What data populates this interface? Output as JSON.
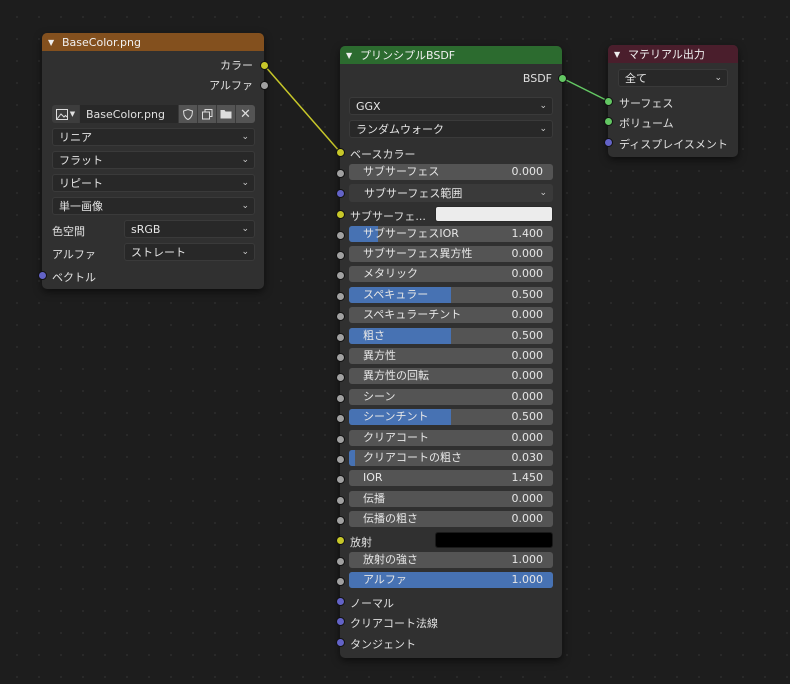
{
  "nodes": {
    "image": {
      "title": "BaseColor.png",
      "header_color": "#83501e",
      "outputs": [
        "カラー",
        "アルファ"
      ],
      "filename": "BaseColor.png",
      "interpolation": "リニア",
      "projection": "フラット",
      "extension": "リピート",
      "source": "単一画像",
      "colorspace_label": "色空間",
      "colorspace_value": "sRGB",
      "alpha_label": "アルファ",
      "alpha_value": "ストレート",
      "input_vector": "ベクトル"
    },
    "bsdf": {
      "title": "プリンシプルBSDF",
      "header_color": "#2c6b2f",
      "output": "BSDF",
      "distribution": "GGX",
      "subsurface_method": "ランダムウォーク",
      "base_color_label": "ベースカラー",
      "subsurface_radius_label": "サブサーフェス範囲",
      "subsurface_color_label": "サブサーフェ...",
      "emission_label": "放射",
      "normal_label": "ノーマル",
      "clearcoat_normal_label": "クリアコート法線",
      "tangent_label": "タンジェント",
      "fields": [
        {
          "label": "サブサーフェス",
          "value": "0.000",
          "fill": 0
        },
        {
          "label": "サブサーフェスIOR",
          "value": "1.400",
          "fill": 0.14
        },
        {
          "label": "サブサーフェス異方性",
          "value": "0.000",
          "fill": 0
        },
        {
          "label": "メタリック",
          "value": "0.000",
          "fill": 0
        },
        {
          "label": "スペキュラー",
          "value": "0.500",
          "fill": 0.5
        },
        {
          "label": "スペキュラーチント",
          "value": "0.000",
          "fill": 0
        },
        {
          "label": "粗さ",
          "value": "0.500",
          "fill": 0.5
        },
        {
          "label": "異方性",
          "value": "0.000",
          "fill": 0
        },
        {
          "label": "異方性の回転",
          "value": "0.000",
          "fill": 0
        },
        {
          "label": "シーン",
          "value": "0.000",
          "fill": 0
        },
        {
          "label": "シーンチント",
          "value": "0.500",
          "fill": 0.5
        },
        {
          "label": "クリアコート",
          "value": "0.000",
          "fill": 0
        },
        {
          "label": "クリアコートの粗さ",
          "value": "0.030",
          "fill": 0.03
        },
        {
          "label": "IOR",
          "value": "1.450",
          "fill": 0
        },
        {
          "label": "伝播",
          "value": "0.000",
          "fill": 0
        },
        {
          "label": "伝播の粗さ",
          "value": "0.000",
          "fill": 0
        },
        {
          "label": "放射の強さ",
          "value": "1.000",
          "fill": 0
        },
        {
          "label": "アルファ",
          "value": "1.000",
          "fill": 1
        }
      ]
    },
    "output": {
      "title": "マテリアル出力",
      "header_color": "#4a1e2c",
      "target": "全て",
      "inputs": [
        "サーフェス",
        "ボリューム",
        "ディスプレイスメント"
      ]
    }
  }
}
